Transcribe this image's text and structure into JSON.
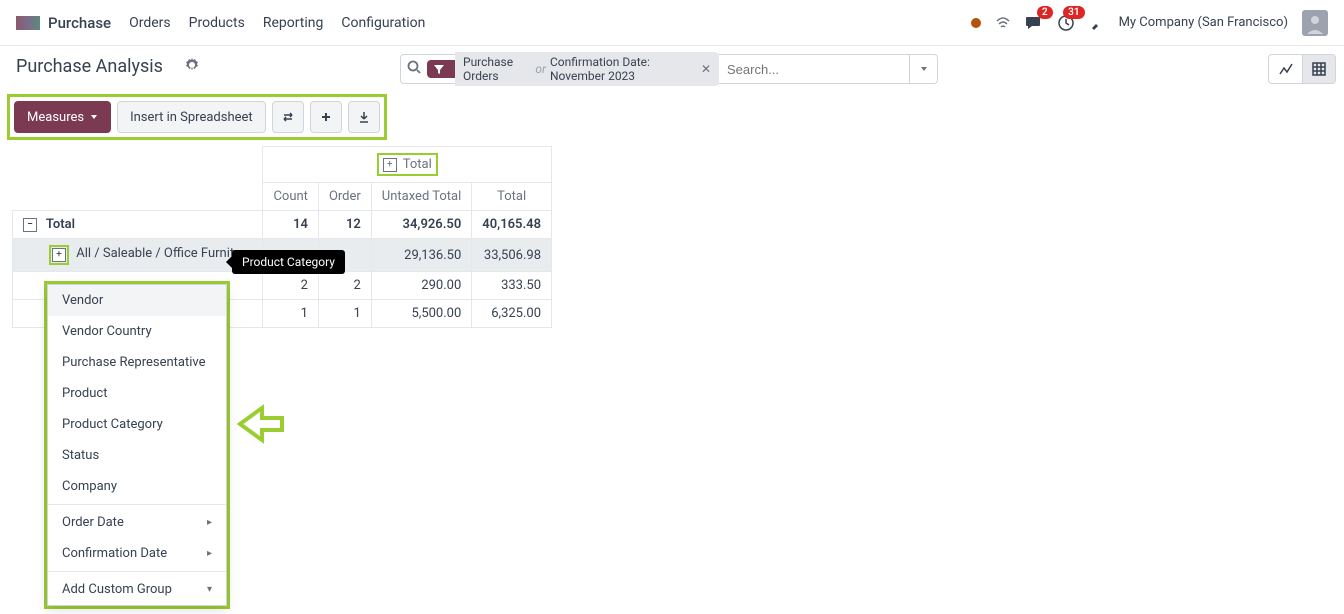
{
  "nav": {
    "brand": "Purchase",
    "items": [
      "Orders",
      "Products",
      "Reporting",
      "Configuration"
    ],
    "company": "My Company (San Francisco)",
    "badges": {
      "chat": "2",
      "clock": "31"
    }
  },
  "page": {
    "title": "Purchase Analysis"
  },
  "search": {
    "filter_label": "Purchase Orders",
    "or": "or",
    "filter_date": "Confirmation Date: November 2023",
    "placeholder": "Search..."
  },
  "toolbar": {
    "measures": "Measures",
    "insert": "Insert in Spreadsheet"
  },
  "pivot": {
    "col_total": "Total",
    "cols": [
      "Count",
      "Order",
      "Untaxed Total",
      "Total"
    ],
    "rows": [
      {
        "label": "Total",
        "level": 0,
        "expanded": true,
        "values": [
          "14",
          "12",
          "34,926.50",
          "40,165.48"
        ],
        "bold": true
      },
      {
        "label": "All / Saleable / Office Furniture",
        "level": 1,
        "expanded": false,
        "values": [
          "",
          "",
          "29,136.50",
          "33,506.98"
        ],
        "active": true
      },
      {
        "label": "",
        "level": 1,
        "expanded": false,
        "values": [
          "2",
          "2",
          "290.00",
          "333.50"
        ]
      },
      {
        "label": "",
        "level": 1,
        "expanded": false,
        "values": [
          "1",
          "1",
          "5,500.00",
          "6,325.00"
        ]
      }
    ]
  },
  "tooltip": {
    "text": "Product Category"
  },
  "dropdown": {
    "items_a": [
      "Vendor",
      "Vendor Country",
      "Purchase Representative",
      "Product",
      "Product Category",
      "Status",
      "Company"
    ],
    "items_b": [
      "Order Date",
      "Confirmation Date"
    ],
    "custom": "Add Custom Group"
  }
}
